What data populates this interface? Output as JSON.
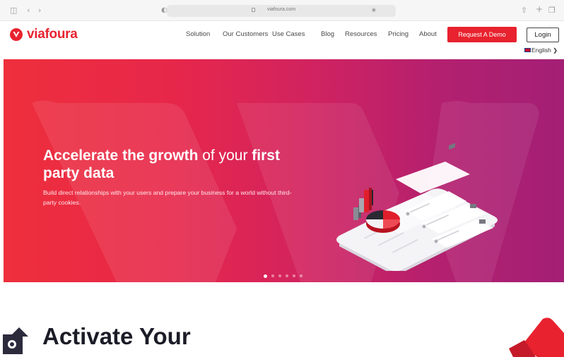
{
  "browser": {
    "url": "viafoura.com",
    "icons": [
      "sidebar-icon",
      "back-icon",
      "forward-icon",
      "privacy-icon",
      "share-icon",
      "new-tab-icon",
      "tabs-icon"
    ]
  },
  "header": {
    "logo_text": "viafoura",
    "nav": [
      "Solution",
      "Our Customers",
      "Use Cases",
      "Blog",
      "Resources",
      "Pricing",
      "About"
    ],
    "demo_label": "Request A Demo",
    "login_label": "Login",
    "language": "English"
  },
  "hero": {
    "title_part1": "Accelerate the growth",
    "title_part2": " of your ",
    "title_part3": "first party data",
    "subtitle": "Build direct relationships with your users and prepare your business for a world without third-party cookies.",
    "carousel_count": 6,
    "carousel_active": 1
  },
  "section": {
    "title": "Activate Your"
  },
  "colors": {
    "brand_red": "#e82330",
    "hero_start": "#ee2f3c",
    "hero_end": "#a31f75",
    "dark": "#1c1c28"
  }
}
